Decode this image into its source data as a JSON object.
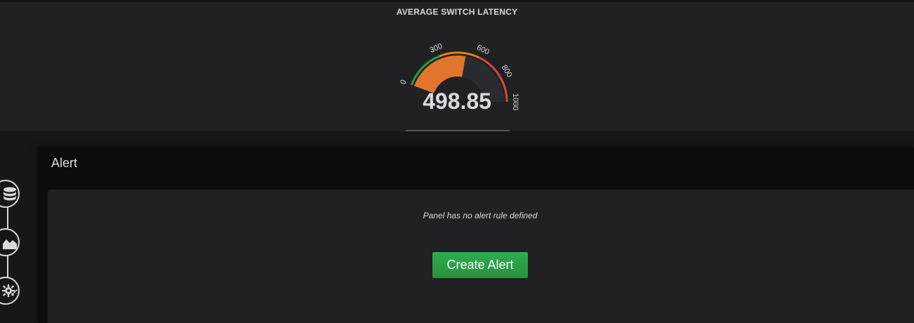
{
  "gauge": {
    "title": "AVERAGE SWITCH LATENCY",
    "value": 498.85,
    "value_label": "498.85",
    "min": 0,
    "max": 1000,
    "tick_labels": [
      "0",
      "300",
      "600",
      "800",
      "1000"
    ],
    "thresholds": [
      {
        "from": 0,
        "to": 300,
        "color": "#299c46"
      },
      {
        "from": 300,
        "to": 600,
        "color": "#eb7b18"
      },
      {
        "from": 600,
        "to": 1000,
        "color": "#d44a3a"
      }
    ],
    "fill_color": "#e0752d"
  },
  "editor": {
    "title": "Alert",
    "message": "Panel has no alert rule defined",
    "create_button_label": "Create Alert"
  },
  "rail": {
    "items": [
      {
        "icon": "database-icon"
      },
      {
        "icon": "area-chart-icon"
      },
      {
        "icon": "gear-wrench-icon"
      }
    ]
  }
}
